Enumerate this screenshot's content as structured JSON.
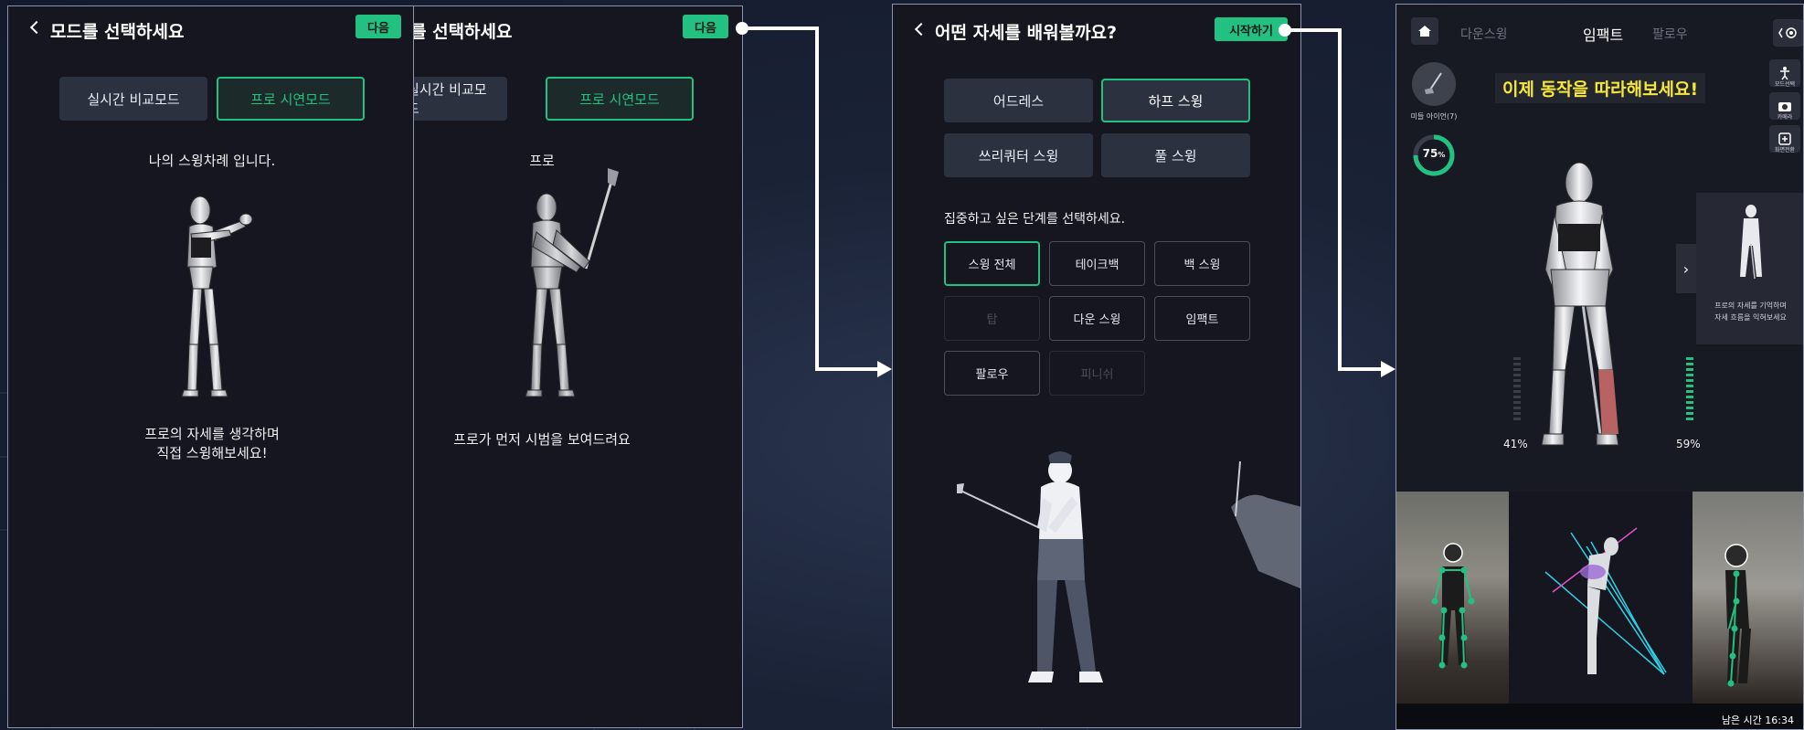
{
  "screen1": {
    "title": "모드를 선택하세요",
    "next_label": "다음",
    "mode_realtime": "실시간 비교모드",
    "mode_pro": "프로 시연모드",
    "caption_top": "나의 스윙차례 입니다.",
    "caption_bottom_line1": "프로의 자세를 생각하며",
    "caption_bottom_line2": "직접 스윙해보세요!"
  },
  "screen2": {
    "title": "를 선택하세요",
    "next_label": "다음",
    "mode_realtime": "실시간 비교모드",
    "mode_pro": "프로 시연모드",
    "caption_top": "프로",
    "caption_bottom": "프로가 먼저 시범을 보여드려요"
  },
  "screen3": {
    "title": "어떤 자세를 배워볼까요?",
    "start_label": "시작하기",
    "poses": [
      "어드레스",
      "하프 스윙",
      "쓰리쿼터 스윙",
      "풀 스윙"
    ],
    "stage_prompt": "집중하고 싶은 단계를 선택하세요.",
    "stages": [
      "스윙 전체",
      "테이크백",
      "백 스윙",
      "탑",
      "다운 스윙",
      "임팩트",
      "팔로우",
      "피니쉬"
    ]
  },
  "screen4": {
    "tabs": [
      "다운스윙",
      "임팩트",
      "팔로우"
    ],
    "club_label": "미들 아이언(7)",
    "progress_value": "75",
    "progress_unit": "%",
    "banner": "이제 동작을 따라해보세요!",
    "tool_pose": "모드선택",
    "tool_camera": "카메라",
    "tool_rotate": "화면전환",
    "hint_line1": "프로의 자세를 기억하며",
    "hint_line2": "자세 흐름을 익혀보세요",
    "left_pct": "41%",
    "right_pct": "59%",
    "remaining": "남은 시간 16:34"
  },
  "colors": {
    "accent": "#22c081",
    "banner_text": "#f6e83a",
    "panel": "#15161f",
    "option": "#2c3140"
  }
}
